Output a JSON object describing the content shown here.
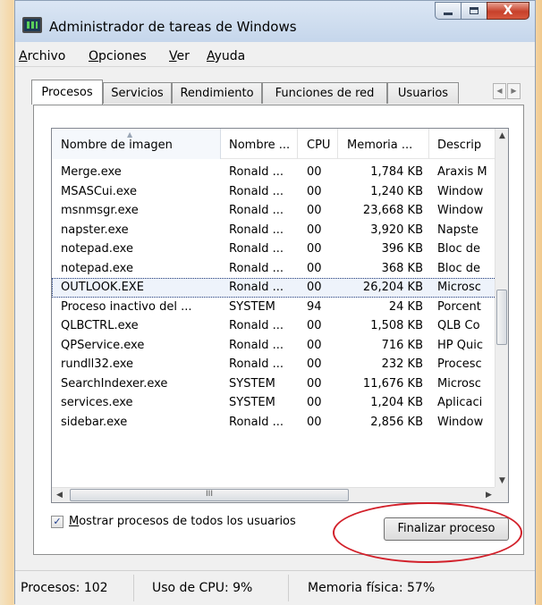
{
  "window": {
    "title": "Administrador de tareas de Windows",
    "close_glyph": "X"
  },
  "menu": [
    "Archivo",
    "Opciones",
    "Ver",
    "Ayuda"
  ],
  "tabs": [
    "Procesos",
    "Servicios",
    "Rendimiento",
    "Funciones de red",
    "Usuarios"
  ],
  "processes": {
    "columns": [
      "Nombre de imagen",
      "Nombre ...",
      "CPU",
      "Memoria ...",
      "Descrip"
    ],
    "rows": [
      [
        "Merge.exe",
        "Ronald ...",
        "00",
        "1,784 KB",
        "Araxis M"
      ],
      [
        "MSASCui.exe",
        "Ronald ...",
        "00",
        "1,240 KB",
        "Window"
      ],
      [
        "msnmsgr.exe",
        "Ronald ...",
        "00",
        "23,668 KB",
        "Window"
      ],
      [
        "napster.exe",
        "Ronald ...",
        "00",
        "3,920 KB",
        "Napste"
      ],
      [
        "notepad.exe",
        "Ronald ...",
        "00",
        "396 KB",
        "Bloc de"
      ],
      [
        "notepad.exe",
        "Ronald ...",
        "00",
        "368 KB",
        "Bloc de"
      ],
      [
        "OUTLOOK.EXE",
        "Ronald ...",
        "00",
        "26,204 KB",
        "Microsc"
      ],
      [
        "Proceso inactivo del ...",
        "SYSTEM",
        "94",
        "24 KB",
        "Porcent"
      ],
      [
        "QLBCTRL.exe",
        "Ronald ...",
        "00",
        "1,508 KB",
        "QLB Co"
      ],
      [
        "QPService.exe",
        "Ronald ...",
        "00",
        "716 KB",
        "HP Quic"
      ],
      [
        "rundll32.exe",
        "Ronald ...",
        "00",
        "232 KB",
        "Procesc"
      ],
      [
        "SearchIndexer.exe",
        "SYSTEM",
        "00",
        "11,676 KB",
        "Microsc"
      ],
      [
        "services.exe",
        "SYSTEM",
        "00",
        "1,204 KB",
        "Aplicaci"
      ],
      [
        "sidebar.exe",
        "Ronald ...",
        "00",
        "2,856 KB",
        "Window"
      ]
    ],
    "selected_row": 6
  },
  "hscroll_thumb_glyph": "III",
  "show_all_users": {
    "label": "Mostrar procesos de todos los usuarios",
    "checked": true,
    "check_glyph": "✓"
  },
  "end_process_label": "Finalizar proceso",
  "status": {
    "processes": "Procesos: 102",
    "cpu": "Uso de CPU: 9%",
    "memory": "Memoria física: 57%"
  }
}
